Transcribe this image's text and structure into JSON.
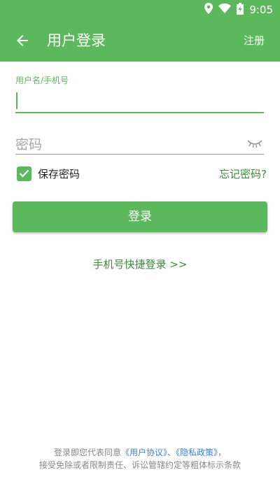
{
  "status_bar": {
    "time": "9:05",
    "icons": [
      "location-icon",
      "wifi-icon",
      "battery-charging-icon"
    ]
  },
  "app_bar": {
    "title": "用户登录",
    "register_label": "注册",
    "back_icon": "arrow-left-icon"
  },
  "form": {
    "username_label": "用户名/手机号",
    "username_value": "",
    "password_placeholder": "密码",
    "password_value": "",
    "remember_label": "保存密码",
    "remember_checked": true,
    "forgot_label": "忘记密码?",
    "login_label": "登录",
    "quick_login_label": "手机号快捷登录 >>"
  },
  "agreement": {
    "prefix": "登录即您代表同意",
    "user_agreement": "《用户协议》",
    "separator": "、",
    "privacy_policy": "《隐私政策》",
    "suffix": "，",
    "line2": "接受免除或者限制责任、诉讼管辖约定等粗体标示条款"
  },
  "colors": {
    "primary": "#5cb85c",
    "link_green": "#3a8a3a",
    "link_blue": "#3f7fd6",
    "muted_text": "#888888"
  }
}
